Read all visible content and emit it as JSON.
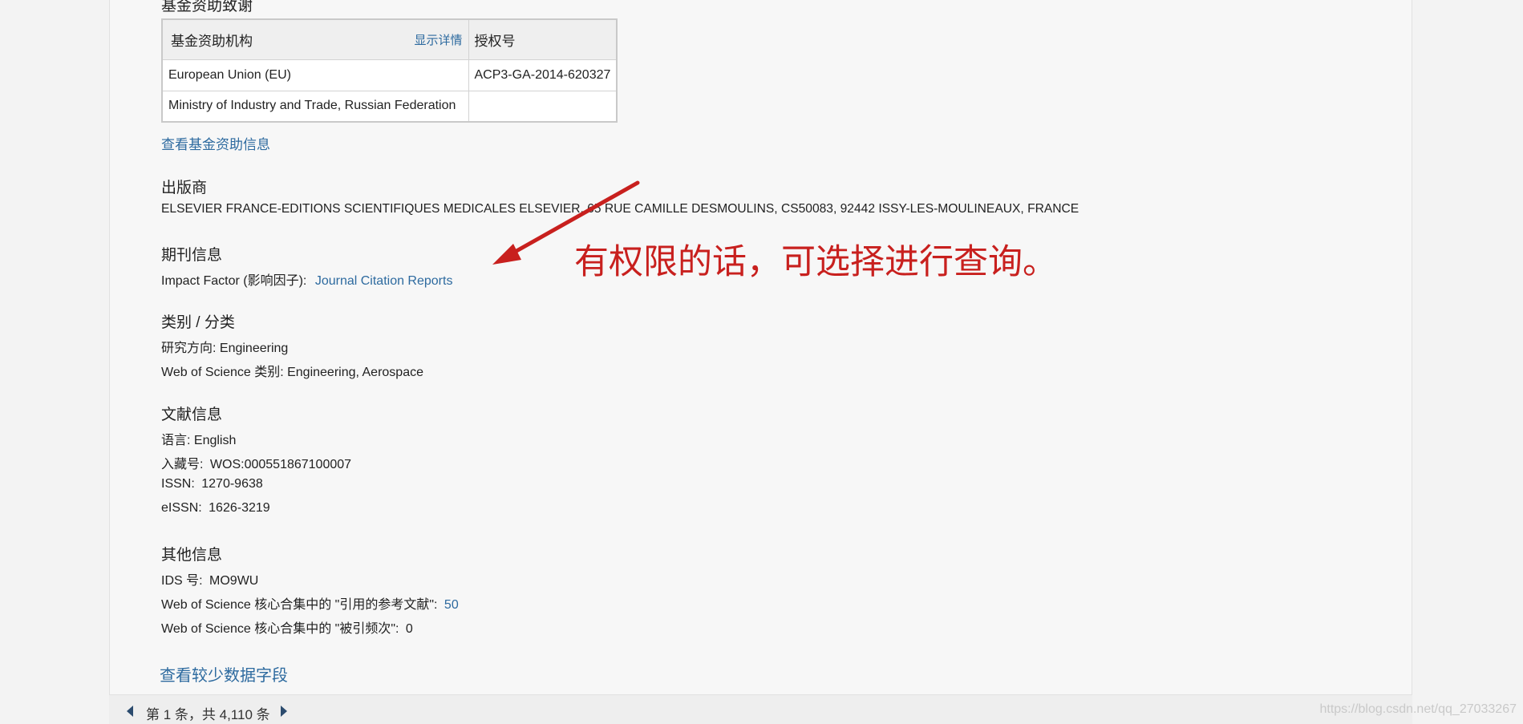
{
  "funding": {
    "section_title": "基金资助致谢",
    "col_agency": "基金资助机构",
    "show_details": "显示详情",
    "col_grant": "授权号",
    "rows": [
      {
        "agency": "European Union (EU)",
        "grant": "ACP3-GA-2014-620327"
      },
      {
        "agency": "Ministry of Industry and Trade, Russian Federation",
        "grant": ""
      }
    ],
    "view_link": "查看基金资助信息"
  },
  "publisher": {
    "title": "出版商",
    "value": "ELSEVIER FRANCE-EDITIONS SCIENTIFIQUES MEDICALES ELSEVIER, 65 RUE CAMILLE DESMOULINS, CS50083, 92442 ISSY-LES-MOULINEAUX, FRANCE"
  },
  "journal": {
    "title": "期刊信息",
    "impact_label": "Impact Factor (影响因子):",
    "impact_link": "Journal Citation Reports"
  },
  "category": {
    "title": "类别 / 分类",
    "research_area": "研究方向: Engineering",
    "wos_category": "Web of Science 类别: Engineering, Aerospace"
  },
  "document": {
    "title": "文献信息",
    "language": "语言: English",
    "accession_label": "入藏号:",
    "accession_value": "WOS:000551867100007",
    "issn_label": "ISSN:",
    "issn_value": "1270-9638",
    "eissn_label": "eISSN:",
    "eissn_value": "1626-3219"
  },
  "other": {
    "title": "其他信息",
    "ids_label": "IDS 号:",
    "ids_value": "MO9WU",
    "cited_refs_label": "Web of Science 核心合集中的 \"引用的参考文献\":",
    "cited_refs_value": "50",
    "times_cited_label": "Web of Science 核心合集中的 \"被引频次\":",
    "times_cited_value": "0"
  },
  "view_fewer": "查看较少数据字段",
  "pager": {
    "text": "第 1 条，共 4,110 条"
  },
  "annotation": {
    "text": "有权限的话，可选择进行查询。",
    "color": "#c8201e"
  },
  "watermark": "https://blog.csdn.net/qq_27033267",
  "colors": {
    "link": "#2d6a9f",
    "annotation": "#c8201e"
  }
}
